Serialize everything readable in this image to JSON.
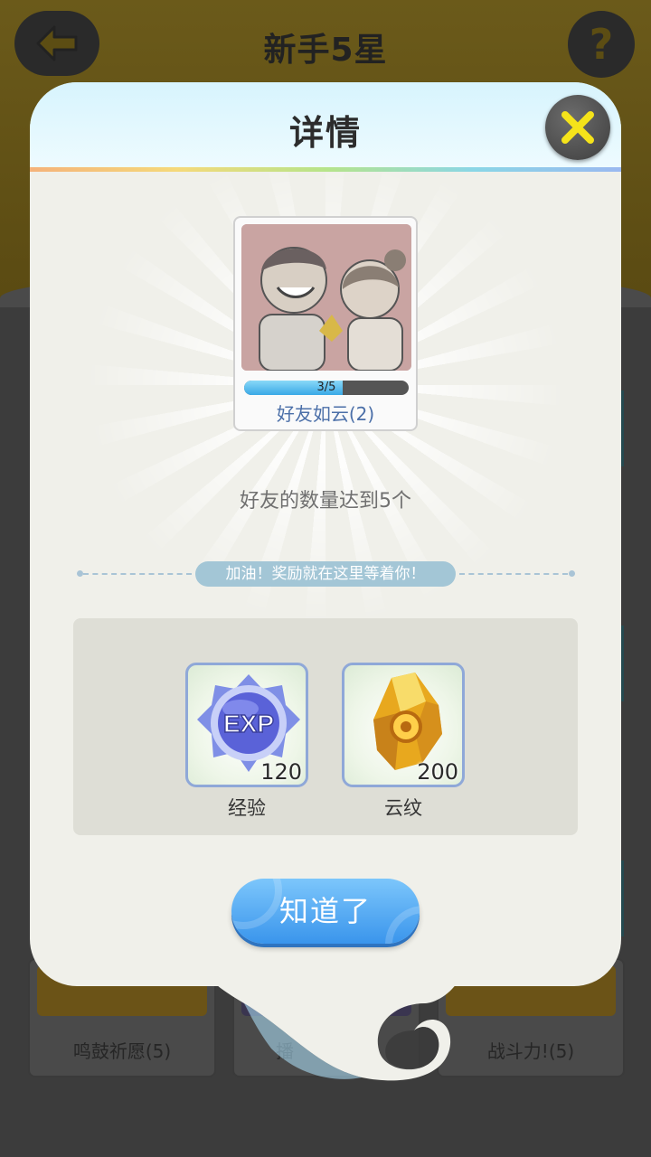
{
  "page": {
    "title": "新手5星",
    "back_icon": "arrow-left-icon",
    "help_icon": "question-icon",
    "help_symbol": "?"
  },
  "background_cards": [
    {
      "label": "鸣鼓祈愿(5)"
    },
    {
      "label": "播"
    },
    {
      "label": "战斗力!(5)"
    }
  ],
  "dialog": {
    "title": "详情",
    "close_icon": "close-x-icon",
    "achievement": {
      "name": "好友如云(2)",
      "progress_text": "3/5",
      "progress_current": 3,
      "progress_total": 5
    },
    "description": "好友的数量达到5个",
    "cheer_text": "加油！奖励就在这里等着你！",
    "rewards": [
      {
        "icon": "exp-orb-icon",
        "count": "120",
        "label": "经验"
      },
      {
        "icon": "gold-crystal-icon",
        "count": "200",
        "label": "云纹"
      }
    ],
    "confirm_label": "知道了"
  },
  "colors": {
    "accent_blue": "#4aa6f2",
    "close_yellow": "#f5e31a",
    "progress_fill": "#5ab8ee"
  }
}
